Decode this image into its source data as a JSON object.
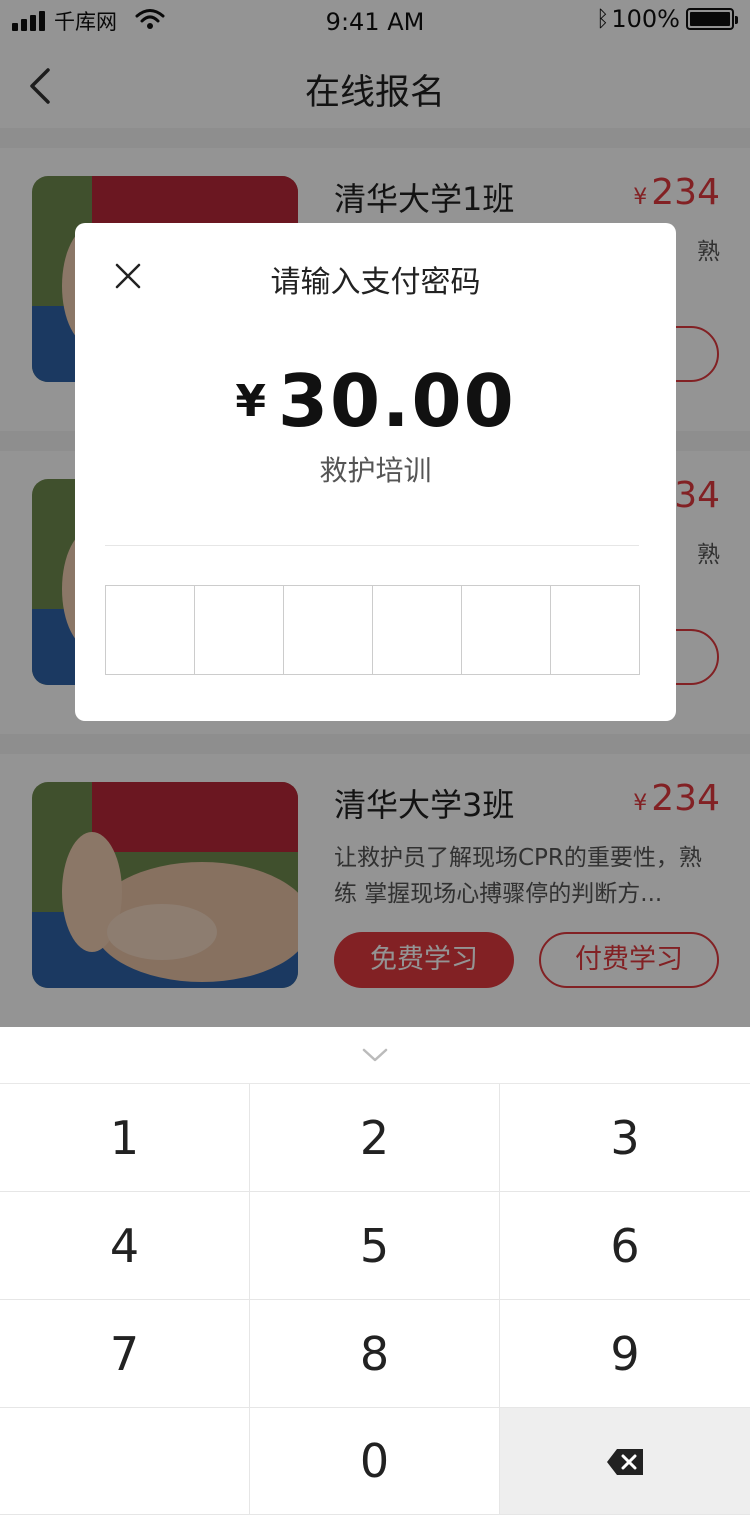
{
  "status_bar": {
    "carrier": "千库网",
    "time": "9:41 AM",
    "battery": "100%",
    "icons": [
      "signal-icon",
      "wifi-icon",
      "bluetooth-icon",
      "battery-icon"
    ]
  },
  "nav": {
    "title": "在线报名",
    "back_icon": "back-arrow-icon"
  },
  "courses": [
    {
      "title": "清华大学1班",
      "price_symbol": "¥",
      "price": "234",
      "desc_visible": "熟",
      "desc": "",
      "free_label": "",
      "paid_label": ""
    },
    {
      "title": "",
      "price_symbol": "",
      "price": "34",
      "desc_visible": "熟",
      "desc": "",
      "free_label": "",
      "paid_label": ""
    },
    {
      "title": "清华大学3班",
      "price_symbol": "¥",
      "price": "234",
      "desc": "让救护员了解现场CPR的重要性，熟练 掌握现场心搏骤停的判断方...",
      "free_label": "免费学习",
      "paid_label": "付费学习"
    }
  ],
  "pay_dialog": {
    "title": "请输入支付密码",
    "currency_symbol": "¥",
    "amount": "30.00",
    "description": "救护培训",
    "password_length": 6
  },
  "keypad": {
    "handle_icon": "chevron-down-icon",
    "keys": [
      "1",
      "2",
      "3",
      "4",
      "5",
      "6",
      "7",
      "8",
      "9",
      "",
      "0",
      "delete"
    ],
    "delete_icon": "backspace-icon"
  },
  "colors": {
    "accent": "#e0393e",
    "overlay": "rgba(0,0,0,0.42)"
  }
}
